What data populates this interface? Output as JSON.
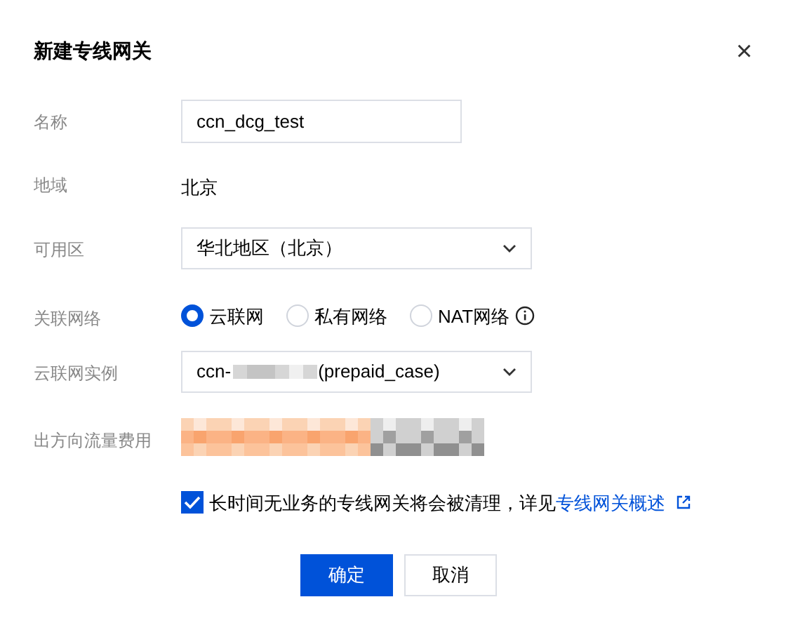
{
  "dialog": {
    "title": "新建专线网关",
    "close": "×"
  },
  "fields": [
    {
      "kind": "input",
      "label": "名称",
      "value": "ccn_dcg_test"
    },
    {
      "kind": "text",
      "label": "地域",
      "value": "北京"
    },
    {
      "kind": "select",
      "label": "可用区",
      "value_before": "华北地区（北京）"
    },
    {
      "kind": "radio",
      "label": "关联网络",
      "options": [
        {
          "label": "云联网",
          "selected": true,
          "info": false
        },
        {
          "label": "私有网络",
          "selected": false,
          "info": false
        },
        {
          "label": "NAT网络",
          "selected": false,
          "info": true
        }
      ]
    },
    {
      "kind": "select",
      "label": "云联网实例",
      "value_before": "ccn-",
      "redacted": true,
      "value_after": "(prepaid_case)"
    },
    {
      "kind": "redacted",
      "label": "出方向流量费用"
    }
  ],
  "agreement": {
    "checked": true,
    "text": "长时间无业务的专线网关将会被清理，详见",
    "link": "专线网关概述"
  },
  "buttons": [
    {
      "label": "确定",
      "primary": true
    },
    {
      "label": "取消",
      "primary": false
    }
  ]
}
